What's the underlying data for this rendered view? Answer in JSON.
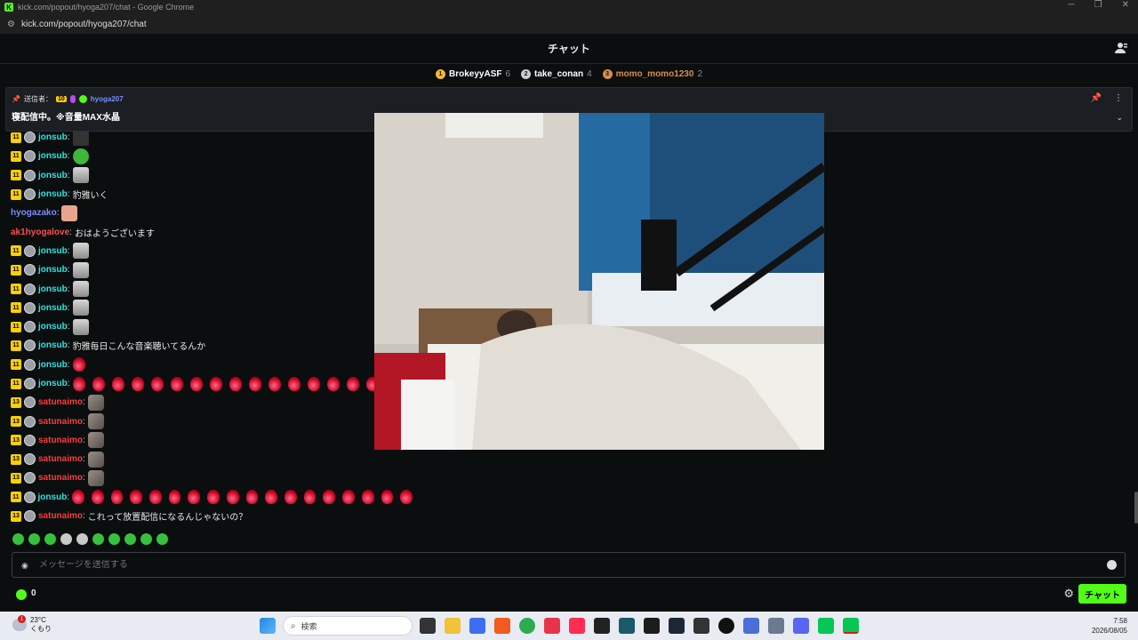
{
  "window": {
    "title": "kick.com/popout/hyoga207/chat - Google Chrome",
    "url": "kick.com/popout/hyoga207/chat"
  },
  "header": {
    "title": "チャット"
  },
  "leaderboard": [
    {
      "rank": "1",
      "name": "BrokeyyASF",
      "count": "6",
      "color": "#f5b82e"
    },
    {
      "rank": "2",
      "name": "take_conan",
      "count": "4",
      "color": "#c9ccd1"
    },
    {
      "rank": "3",
      "name": "momo_momo1230",
      "count": "2",
      "color": "#d98f4a"
    }
  ],
  "pinned": {
    "label": "送信者：",
    "badge": "10",
    "user": "hyoga207",
    "message": "寝配信中。※音量MAX水晶"
  },
  "messages": [
    {
      "sub": "11",
      "user": "jonsub",
      "color": "#2ee3e0",
      "text": "",
      "emotes": [
        "mute"
      ]
    },
    {
      "sub": "11",
      "user": "jonsub",
      "color": "#2ee3e0",
      "text": "",
      "emotes": [
        "pepe"
      ]
    },
    {
      "sub": "11",
      "user": "jonsub",
      "color": "#2ee3e0",
      "text": "",
      "emotes": [
        "face"
      ]
    },
    {
      "sub": "11",
      "user": "jonsub",
      "color": "#2ee3e0",
      "text": "豹雅いく",
      "emotes": []
    },
    {
      "sub": "",
      "user": "hyogazako",
      "color": "#7a8dff",
      "text": "",
      "emotes": [
        "peach"
      ]
    },
    {
      "sub": "",
      "user": "ak1hyogalove",
      "color": "#ff4d4d",
      "text": "おはようございます",
      "emotes": []
    },
    {
      "sub": "11",
      "user": "jonsub",
      "color": "#2ee3e0",
      "text": "",
      "emotes": [
        "face"
      ]
    },
    {
      "sub": "11",
      "user": "jonsub",
      "color": "#2ee3e0",
      "text": "",
      "emotes": [
        "face"
      ]
    },
    {
      "sub": "11",
      "user": "jonsub",
      "color": "#2ee3e0",
      "text": "",
      "emotes": [
        "face"
      ]
    },
    {
      "sub": "11",
      "user": "jonsub",
      "color": "#2ee3e0",
      "text": "",
      "emotes": [
        "face"
      ]
    },
    {
      "sub": "11",
      "user": "jonsub",
      "color": "#2ee3e0",
      "text": "",
      "emotes": [
        "face"
      ]
    },
    {
      "sub": "11",
      "user": "jonsub",
      "color": "#2ee3e0",
      "text": "豹雅毎日こんな音楽聴いてるんか",
      "emotes": []
    },
    {
      "sub": "11",
      "user": "jonsub",
      "color": "#2ee3e0",
      "text": "",
      "emotes": [
        "drop"
      ]
    },
    {
      "sub": "11",
      "user": "jonsub",
      "color": "#2ee3e0",
      "text": "",
      "emotes": [
        "drop",
        "drop",
        "drop",
        "drop",
        "drop",
        "drop",
        "drop",
        "drop",
        "drop",
        "drop",
        "drop",
        "drop",
        "drop",
        "drop",
        "drop",
        "drop"
      ]
    },
    {
      "sub": "13",
      "user": "satunaimo",
      "color": "#ff3b3b",
      "text": "",
      "emotes": [
        "rock"
      ]
    },
    {
      "sub": "13",
      "user": "satunaimo",
      "color": "#ff3b3b",
      "text": "",
      "emotes": [
        "rock"
      ]
    },
    {
      "sub": "13",
      "user": "satunaimo",
      "color": "#ff3b3b",
      "text": "",
      "emotes": [
        "rock"
      ]
    },
    {
      "sub": "13",
      "user": "satunaimo",
      "color": "#ff3b3b",
      "text": "",
      "emotes": [
        "rock"
      ]
    },
    {
      "sub": "13",
      "user": "satunaimo",
      "color": "#ff3b3b",
      "text": "",
      "emotes": [
        "rock"
      ]
    },
    {
      "sub": "11",
      "user": "jonsub",
      "color": "#2ee3e0",
      "text": "",
      "emotes": [
        "drop",
        "drop",
        "drop",
        "drop",
        "drop",
        "drop",
        "drop",
        "drop",
        "drop",
        "drop",
        "drop",
        "drop",
        "drop",
        "drop",
        "drop",
        "drop",
        "drop",
        "drop"
      ]
    },
    {
      "sub": "13",
      "user": "satunaimo",
      "color": "#ff3b3b",
      "text": "これって放置配信になるんじゃないの？",
      "emotes": []
    }
  ],
  "input": {
    "placeholder": "メッセージを送信する"
  },
  "footer": {
    "kick_count": "0",
    "chat_button": "チャット"
  },
  "taskbar": {
    "temp": "23°C",
    "weather": "くもり",
    "search_placeholder": "検索",
    "time": "7:58",
    "date": "2026/08/05",
    "notification_count": "1"
  },
  "colors": {
    "accent": "#53fc18",
    "background": "#0b0e0f"
  }
}
